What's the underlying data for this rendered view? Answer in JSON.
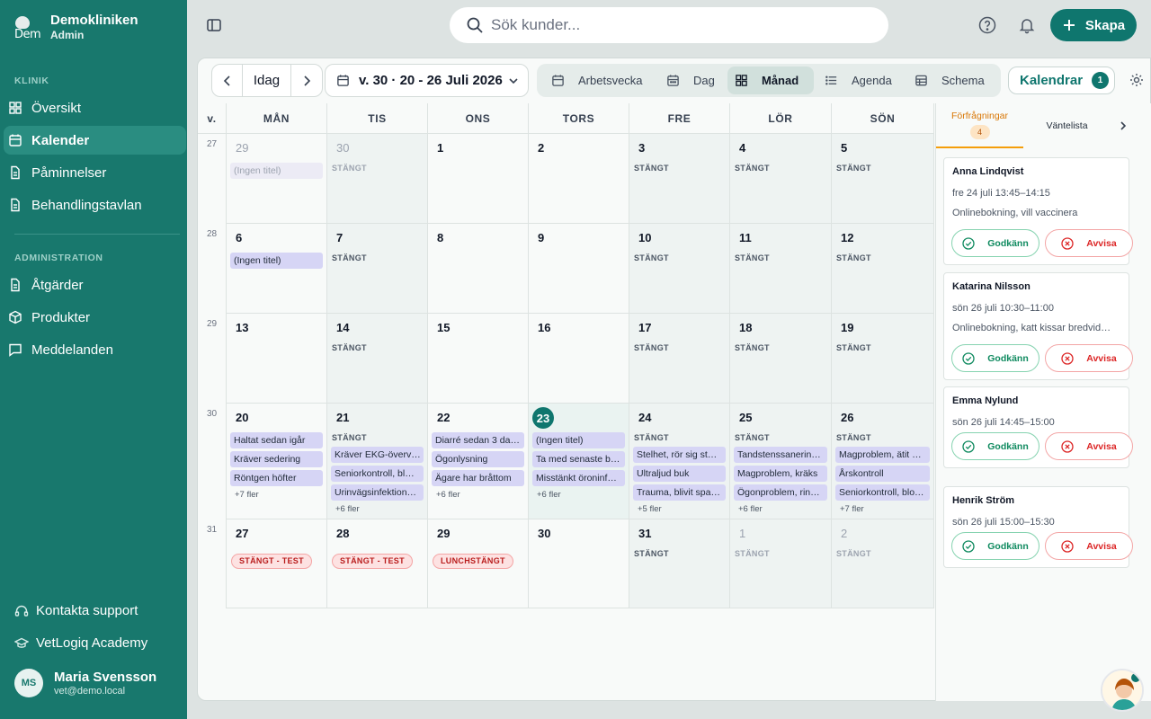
{
  "brand": {
    "name": "Demokliniken",
    "role": "Admin",
    "logo_text": "Dem"
  },
  "nav": {
    "section_clinic": "KLINIK",
    "items": [
      {
        "label": "Översikt",
        "icon": "grid-icon"
      },
      {
        "label": "Kalender",
        "icon": "calendar-icon"
      },
      {
        "label": "Påminnelser",
        "icon": "file-icon"
      },
      {
        "label": "Behandlingstavlan",
        "icon": "file-icon"
      }
    ],
    "section_admin": "ADMINISTRATION",
    "admin_items": [
      {
        "label": "Åtgärder",
        "icon": "file-icon"
      },
      {
        "label": "Produkter",
        "icon": "box-icon"
      },
      {
        "label": "Meddelanden",
        "icon": "message-icon"
      }
    ],
    "support": "Kontakta support",
    "academy": "VetLogiq Academy"
  },
  "user": {
    "initials": "MS",
    "name": "Maria Svensson",
    "email": "vet@demo.local"
  },
  "search": {
    "placeholder": "Sök kunder..."
  },
  "create_label": "Skapa",
  "toolbar": {
    "today": "Idag",
    "range": "v. 30 · 20 - 26 Juli 2026",
    "views": [
      "Arbetsvecka",
      "Dag",
      "Månad",
      "Agenda",
      "Schema"
    ],
    "active_view": "Månad",
    "calendars_label": "Kalendrar",
    "calendars_count": "1"
  },
  "calendar": {
    "week_header": "v.",
    "days": [
      "MÅN",
      "TIS",
      "ONS",
      "TORS",
      "FRE",
      "LÖR",
      "SÖN"
    ],
    "closed_label": "STÄNGT",
    "weeks": [
      {
        "week": "27",
        "cells": [
          {
            "num": "29",
            "other": true,
            "events": [
              "(Ingen titel)"
            ]
          },
          {
            "num": "30",
            "other": true,
            "closed": true
          },
          {
            "num": "1"
          },
          {
            "num": "2"
          },
          {
            "num": "3",
            "closed": true
          },
          {
            "num": "4",
            "closed": true
          },
          {
            "num": "5",
            "closed": true
          }
        ]
      },
      {
        "week": "28",
        "cells": [
          {
            "num": "6",
            "events": [
              "(Ingen titel)"
            ]
          },
          {
            "num": "7",
            "closed": true
          },
          {
            "num": "8"
          },
          {
            "num": "9"
          },
          {
            "num": "10",
            "closed": true
          },
          {
            "num": "11",
            "closed": true
          },
          {
            "num": "12",
            "closed": true
          }
        ]
      },
      {
        "week": "29",
        "cells": [
          {
            "num": "13"
          },
          {
            "num": "14",
            "closed": true
          },
          {
            "num": "15"
          },
          {
            "num": "16"
          },
          {
            "num": "17",
            "closed": true
          },
          {
            "num": "18",
            "closed": true
          },
          {
            "num": "19",
            "closed": true
          }
        ]
      },
      {
        "week": "30",
        "cells": [
          {
            "num": "20",
            "events": [
              "Haltat sedan igår",
              "Kräver sedering",
              "Röntgen höfter"
            ],
            "more": "+7 fler"
          },
          {
            "num": "21",
            "closed": true,
            "events": [
              "Kräver EKG-överv…",
              "Seniorkontroll, bl…",
              "Urinvägsinfektion…"
            ],
            "more": "+6 fler"
          },
          {
            "num": "22",
            "events": [
              "Diarré sedan 3 da…",
              "Ögonlysning",
              "Ägare har bråttom"
            ],
            "more": "+6 fler"
          },
          {
            "num": "23",
            "today": true,
            "events": [
              "(Ingen titel)",
              "Ta med senaste b…",
              "Misstänkt öroninf…"
            ],
            "more": "+6 fler"
          },
          {
            "num": "24",
            "closed": true,
            "events": [
              "Stelhet, rör sig st…",
              "Ultraljud buk",
              "Trauma, blivit spa…"
            ],
            "more": "+5 fler"
          },
          {
            "num": "25",
            "closed": true,
            "events": [
              "Tandstenssanerin…",
              "Magproblem, kräks",
              "Ögonproblem, rin…"
            ],
            "more": "+6 fler"
          },
          {
            "num": "26",
            "closed": true,
            "events": [
              "Magproblem, ätit …",
              "Årskontroll",
              "Seniorkontroll, blo…"
            ],
            "more": "+7 fler"
          }
        ]
      },
      {
        "week": "31",
        "cells": [
          {
            "num": "27",
            "badge": "STÄNGT - TEST"
          },
          {
            "num": "28",
            "badge": "STÄNGT - TEST"
          },
          {
            "num": "29",
            "badge": "LUNCHSTÄNGT"
          },
          {
            "num": "30"
          },
          {
            "num": "31",
            "closed": true
          },
          {
            "num": "1",
            "other": true,
            "closed": true
          },
          {
            "num": "2",
            "other": true,
            "closed": true
          }
        ]
      }
    ]
  },
  "requests_panel": {
    "tab_requests": "Förfrågningar",
    "requests_count": "4",
    "tab_waitlist": "Väntelista",
    "approve": "Godkänn",
    "reject": "Avvisa",
    "items": [
      {
        "name": "Anna Lindqvist",
        "time": "fre 24 juli 13:45–14:15",
        "note": "Onlinebokning, vill vaccinera"
      },
      {
        "name": "Katarina Nilsson",
        "time": "sön 26 juli 10:30–11:00",
        "note": "Onlinebokning, katt kissar bredvid…"
      },
      {
        "name": "Emma Nylund",
        "time": "sön 26 juli 14:45–15:00",
        "note": ""
      },
      {
        "name": "Henrik Ström",
        "time": "sön 26 juli 15:00–15:30",
        "note": ""
      }
    ]
  },
  "colors": {
    "sidebar": "#18786d",
    "accent": "#0f766e",
    "event": "#d6d5f5",
    "warning": "#f59e0b",
    "danger": "#dc2626",
    "success": "#0f8a5f"
  }
}
